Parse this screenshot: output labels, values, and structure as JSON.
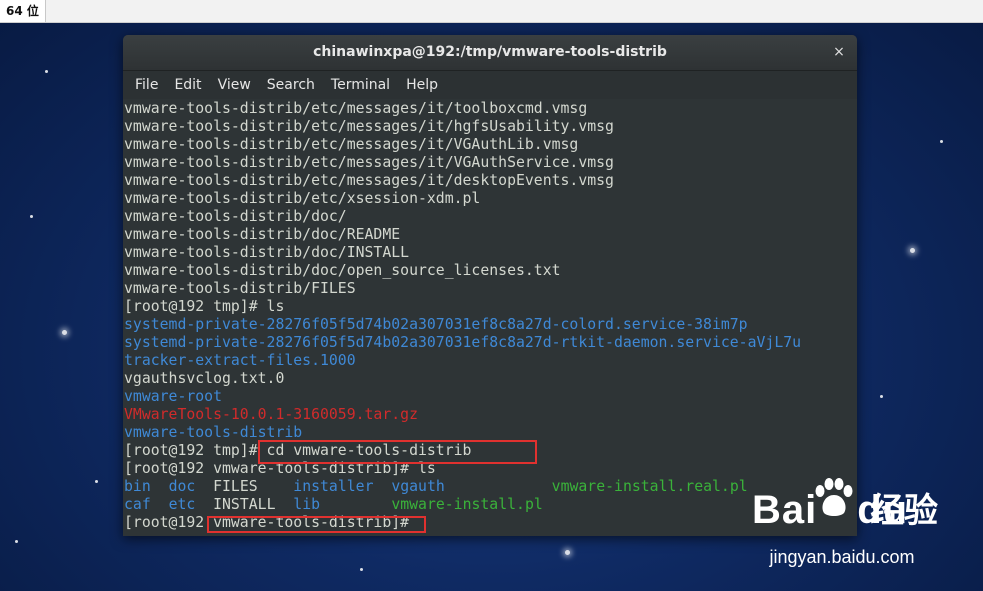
{
  "host_tab": {
    "label": "64 位"
  },
  "window": {
    "title": "chinawinxpa@192:/tmp/vmware-tools-distrib",
    "close_glyph": "×"
  },
  "menu": [
    "File",
    "Edit",
    "View",
    "Search",
    "Terminal",
    "Help"
  ],
  "terminal_lines": [
    [
      {
        "t": "vmware-tools-distrib/etc/messages/it/toolboxcmd.vmsg",
        "c": "fg"
      }
    ],
    [
      {
        "t": "vmware-tools-distrib/etc/messages/it/hgfsUsability.vmsg",
        "c": "fg"
      }
    ],
    [
      {
        "t": "vmware-tools-distrib/etc/messages/it/VGAuthLib.vmsg",
        "c": "fg"
      }
    ],
    [
      {
        "t": "vmware-tools-distrib/etc/messages/it/VGAuthService.vmsg",
        "c": "fg"
      }
    ],
    [
      {
        "t": "vmware-tools-distrib/etc/messages/it/desktopEvents.vmsg",
        "c": "fg"
      }
    ],
    [
      {
        "t": "vmware-tools-distrib/etc/xsession-xdm.pl",
        "c": "fg"
      }
    ],
    [
      {
        "t": "vmware-tools-distrib/doc/",
        "c": "fg"
      }
    ],
    [
      {
        "t": "vmware-tools-distrib/doc/README",
        "c": "fg"
      }
    ],
    [
      {
        "t": "vmware-tools-distrib/doc/INSTALL",
        "c": "fg"
      }
    ],
    [
      {
        "t": "vmware-tools-distrib/doc/open_source_licenses.txt",
        "c": "fg"
      }
    ],
    [
      {
        "t": "vmware-tools-distrib/FILES",
        "c": "fg"
      }
    ],
    [
      {
        "t": "[root@192 tmp]# ls",
        "c": "fg"
      }
    ],
    [
      {
        "t": "systemd-private-28276f05f5d74b02a307031ef8c8a27d-colord.service-38im7p",
        "c": "blue"
      }
    ],
    [
      {
        "t": "systemd-private-28276f05f5d74b02a307031ef8c8a27d-rtkit-daemon.service-aVjL7u",
        "c": "blue"
      }
    ],
    [
      {
        "t": "tracker-extract-files.1000",
        "c": "blue"
      }
    ],
    [
      {
        "t": "vgauthsvclog.txt.0",
        "c": "fg"
      }
    ],
    [
      {
        "t": "vmware-root",
        "c": "blue"
      }
    ],
    [
      {
        "t": "VMwareTools-10.0.1-3160059.tar.gz",
        "c": "red"
      }
    ],
    [
      {
        "t": "vmware-tools-distrib",
        "c": "blue"
      }
    ],
    [
      {
        "t": "[root@192 tmp]# cd vmware-tools-distrib",
        "c": "fg"
      }
    ],
    [
      {
        "t": "[root@192 vmware-tools-distrib]# ls",
        "c": "fg"
      }
    ],
    [
      {
        "t": "bin",
        "c": "blue"
      },
      {
        "t": "  ",
        "c": "fg"
      },
      {
        "t": "doc",
        "c": "blue"
      },
      {
        "t": "  FILES    ",
        "c": "fg"
      },
      {
        "t": "installer",
        "c": "blue"
      },
      {
        "t": "  ",
        "c": "fg"
      },
      {
        "t": "vgauth",
        "c": "blue"
      },
      {
        "t": "            ",
        "c": "fg"
      },
      {
        "t": "vmware-install.real.pl",
        "c": "green"
      }
    ],
    [
      {
        "t": "caf",
        "c": "blue"
      },
      {
        "t": "  ",
        "c": "fg"
      },
      {
        "t": "etc",
        "c": "blue"
      },
      {
        "t": "  INSTALL  ",
        "c": "fg"
      },
      {
        "t": "lib",
        "c": "blue"
      },
      {
        "t": "        ",
        "c": "fg"
      },
      {
        "t": "vmware-install.pl",
        "c": "green"
      }
    ],
    [
      {
        "t": "[root@192 vmware-tools-distrib]# ",
        "c": "fg"
      }
    ]
  ],
  "watermark": {
    "logo": "Bai",
    "logo_suffix": "du",
    "cn_text": "经验",
    "url": "jingyan.baidu.com"
  },
  "colors": {
    "fg": "#d3d7cf",
    "blue": "#3f89d6",
    "red": "#d12b2b",
    "green": "#3ab23a",
    "highlight": "#e0312f"
  }
}
